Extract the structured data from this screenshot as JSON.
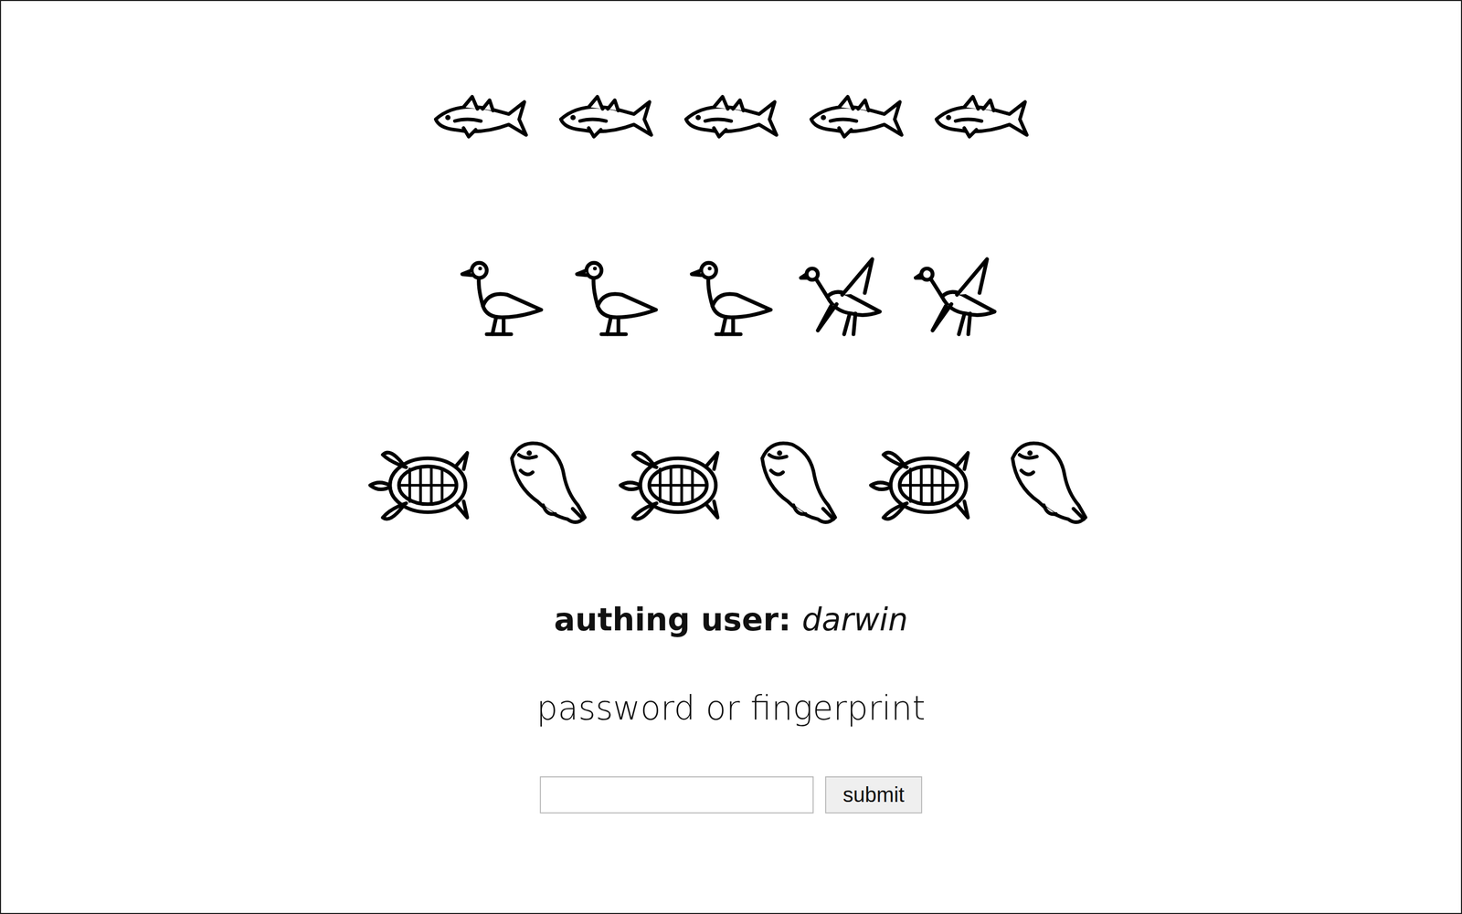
{
  "glyph_rows": [
    {
      "items": [
        {
          "kind": "fish"
        },
        {
          "kind": "fish"
        },
        {
          "kind": "fish"
        },
        {
          "kind": "fish"
        },
        {
          "kind": "fish"
        }
      ]
    },
    {
      "items": [
        {
          "kind": "standing-bird"
        },
        {
          "kind": "standing-bird"
        },
        {
          "kind": "standing-bird"
        },
        {
          "kind": "flying-bird"
        },
        {
          "kind": "flying-bird"
        }
      ]
    },
    {
      "items": [
        {
          "kind": "turtle"
        },
        {
          "kind": "pufferfish"
        },
        {
          "kind": "turtle"
        },
        {
          "kind": "pufferfish"
        },
        {
          "kind": "turtle"
        },
        {
          "kind": "pufferfish"
        }
      ]
    }
  ],
  "user": {
    "label": "authing user: ",
    "name": "darwin"
  },
  "prompt": "password or fingerprint",
  "field": {
    "value": ""
  },
  "button": "submit"
}
